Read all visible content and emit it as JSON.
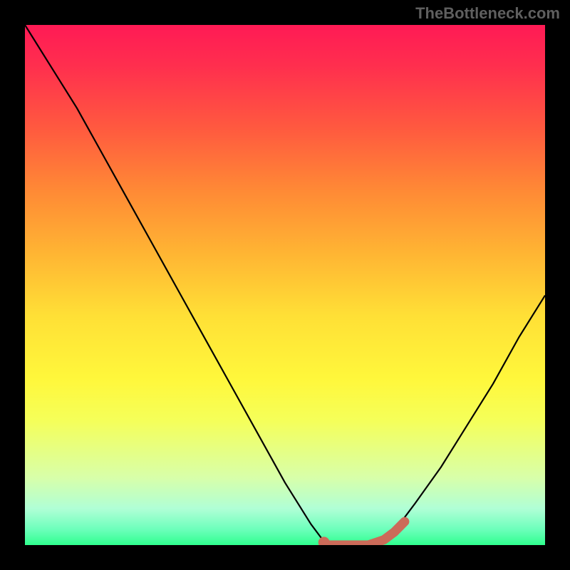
{
  "watermark": "TheBottleneck.com",
  "chart_data": {
    "type": "line",
    "title": "",
    "xlabel": "",
    "ylabel": "",
    "x": [
      0.0,
      0.05,
      0.1,
      0.15,
      0.2,
      0.25,
      0.3,
      0.35,
      0.4,
      0.45,
      0.5,
      0.55,
      0.58,
      0.6,
      0.62,
      0.65,
      0.68,
      0.72,
      0.75,
      0.8,
      0.85,
      0.9,
      0.95,
      1.0
    ],
    "y": [
      1.0,
      0.92,
      0.84,
      0.75,
      0.66,
      0.57,
      0.48,
      0.39,
      0.3,
      0.21,
      0.12,
      0.04,
      0.0,
      0.0,
      0.0,
      0.0,
      0.01,
      0.04,
      0.08,
      0.15,
      0.23,
      0.31,
      0.4,
      0.48
    ],
    "xlim": [
      0,
      1
    ],
    "ylim": [
      0,
      1
    ],
    "highlight": {
      "x": [
        0.58,
        0.6,
        0.63,
        0.66,
        0.69,
        0.71,
        0.73
      ],
      "y": [
        0.0,
        0.0,
        0.0,
        0.0,
        0.01,
        0.025,
        0.045
      ],
      "color": "#cc6b59",
      "dot_x": 0.575,
      "dot_y": 0.005
    }
  }
}
